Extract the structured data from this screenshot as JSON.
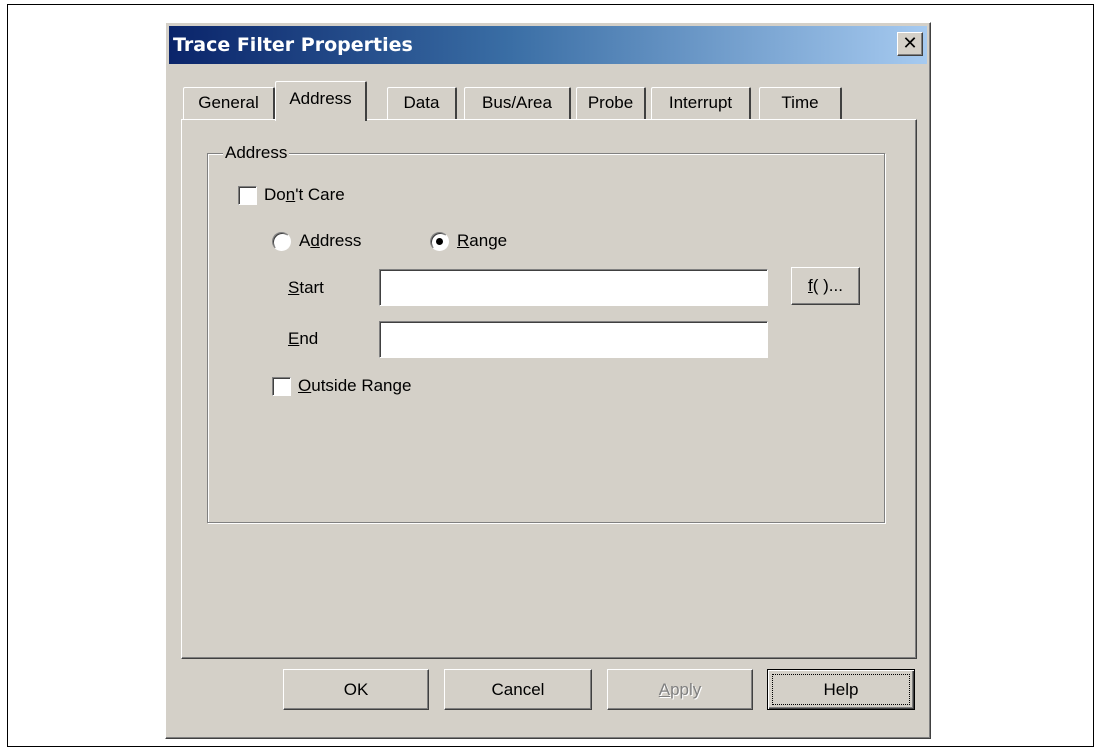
{
  "dialog": {
    "title": "Trace Filter Properties",
    "close_label": "✕"
  },
  "tabs": [
    {
      "label": "General",
      "active": false
    },
    {
      "label": "Address",
      "active": true
    },
    {
      "label": "Data",
      "active": false
    },
    {
      "label": "Bus/Area",
      "active": false
    },
    {
      "label": "Probe",
      "active": false
    },
    {
      "label": "Interrupt",
      "active": false
    },
    {
      "label": "Time",
      "active": false
    }
  ],
  "address_group": {
    "label": "Address",
    "dont_care": {
      "label_pre": "Do",
      "label_key": "n",
      "label_post": "'t Care",
      "checked": false
    },
    "mode_address": {
      "label_pre": "A",
      "label_key": "d",
      "label_post": "dress",
      "selected": false
    },
    "mode_range": {
      "label_key": "R",
      "label_post": "ange",
      "selected": true
    },
    "start": {
      "label_key": "S",
      "label_post": "tart",
      "value": ""
    },
    "end": {
      "label_key": "E",
      "label_post": "nd",
      "value": ""
    },
    "function_button": {
      "label_key": "f",
      "label_post": "( )..."
    },
    "outside_range": {
      "label_key": "O",
      "label_post": "utside Range",
      "checked": false
    }
  },
  "buttons": {
    "ok": "OK",
    "cancel": "Cancel",
    "apply": {
      "label_key": "A",
      "label_post": "pply",
      "enabled": false
    },
    "help": "Help"
  }
}
